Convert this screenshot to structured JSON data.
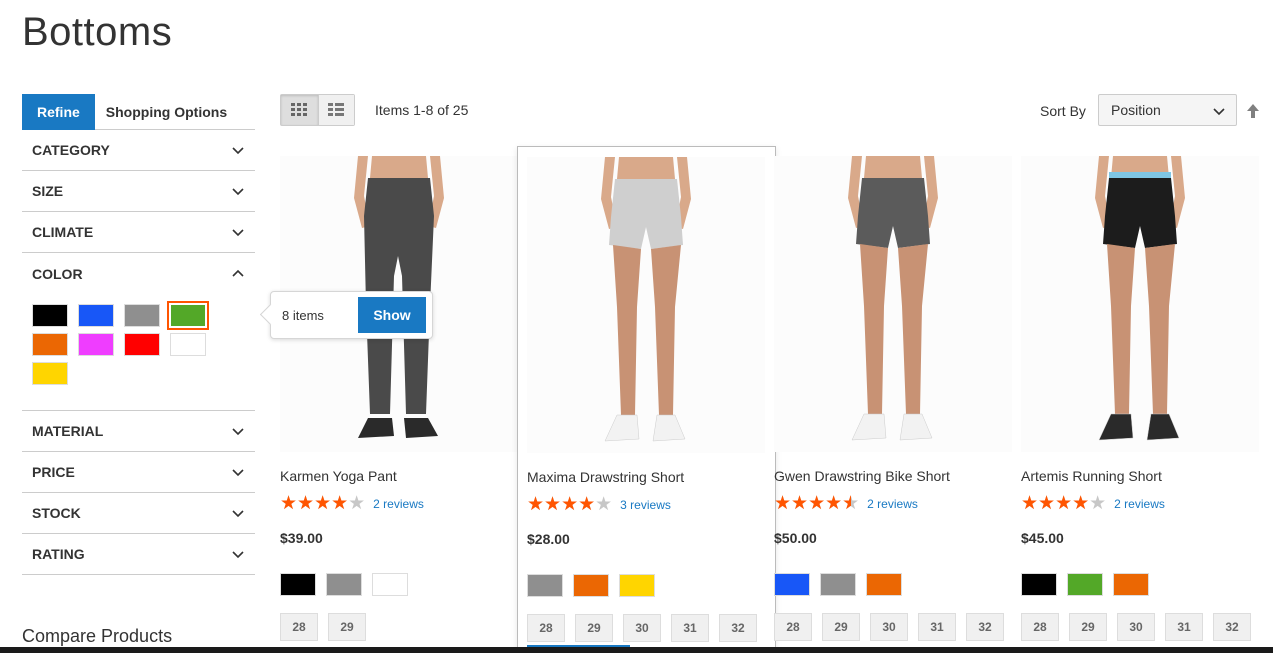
{
  "page": {
    "title": "Bottoms"
  },
  "sidebar": {
    "tabs": {
      "refine": "Refine",
      "shopping": "Shopping Options"
    },
    "filters_top": [
      "CATEGORY",
      "SIZE",
      "CLIMATE"
    ],
    "color_filter": {
      "title": "COLOR",
      "swatches": [
        {
          "name": "black",
          "color": "#000000"
        },
        {
          "name": "blue",
          "color": "#1857f7"
        },
        {
          "name": "gray",
          "color": "#8f8f8f"
        },
        {
          "name": "green",
          "color": "#53a828",
          "selected": true
        },
        {
          "name": "orange",
          "color": "#eb6703"
        },
        {
          "name": "purple",
          "color": "#ef3dff"
        },
        {
          "name": "red",
          "color": "#ff0000"
        },
        {
          "name": "white",
          "color": "#ffffff"
        },
        {
          "name": "yellow",
          "color": "#ffd500"
        }
      ]
    },
    "filters_bottom": [
      "MATERIAL",
      "PRICE",
      "STOCK",
      "RATING"
    ],
    "compare_title": "Compare Products"
  },
  "tooltip": {
    "count": "8 items",
    "button": "Show"
  },
  "toolbar": {
    "items_count": "Items 1-8 of 25",
    "sort_label": "Sort By",
    "sort_value": "Position"
  },
  "colors": {
    "accent": "#1979c3",
    "star": "#ff5501"
  },
  "products": [
    {
      "name": "Karmen Yoga Pant",
      "rating_percent": 80,
      "reviews": "2 reviews",
      "price": "$39.00",
      "colors": [
        "#000000",
        "#8f8f8f",
        "#ffffff"
      ],
      "sizes": [
        "28",
        "29"
      ],
      "type": "pant",
      "garment": "#4a4a4a"
    },
    {
      "name": "Maxima Drawstring Short",
      "rating_percent": 80,
      "reviews": "3 reviews",
      "price": "$28.00",
      "colors": [
        "#8f8f8f",
        "#eb6703",
        "#ffd500"
      ],
      "sizes": [
        "28",
        "29",
        "30",
        "31",
        "32"
      ],
      "type": "short",
      "garment": "#cfcfcf",
      "hovered": true
    },
    {
      "name": "Gwen Drawstring Bike Short",
      "rating_percent": 90,
      "reviews": "2 reviews",
      "price": "$50.00",
      "colors": [
        "#1857f7",
        "#8f8f8f",
        "#eb6703"
      ],
      "sizes": [
        "28",
        "29",
        "30",
        "31",
        "32"
      ],
      "type": "short",
      "garment": "#5b5b5b"
    },
    {
      "name": "Artemis Running Short",
      "rating_percent": 80,
      "reviews": "2 reviews",
      "price": "$45.00",
      "colors": [
        "#000000",
        "#53a828",
        "#eb6703"
      ],
      "sizes": [
        "28",
        "29",
        "30",
        "31",
        "32"
      ],
      "type": "short",
      "garment": "#1c1c1c",
      "waistband": "#7fc6e4"
    }
  ]
}
